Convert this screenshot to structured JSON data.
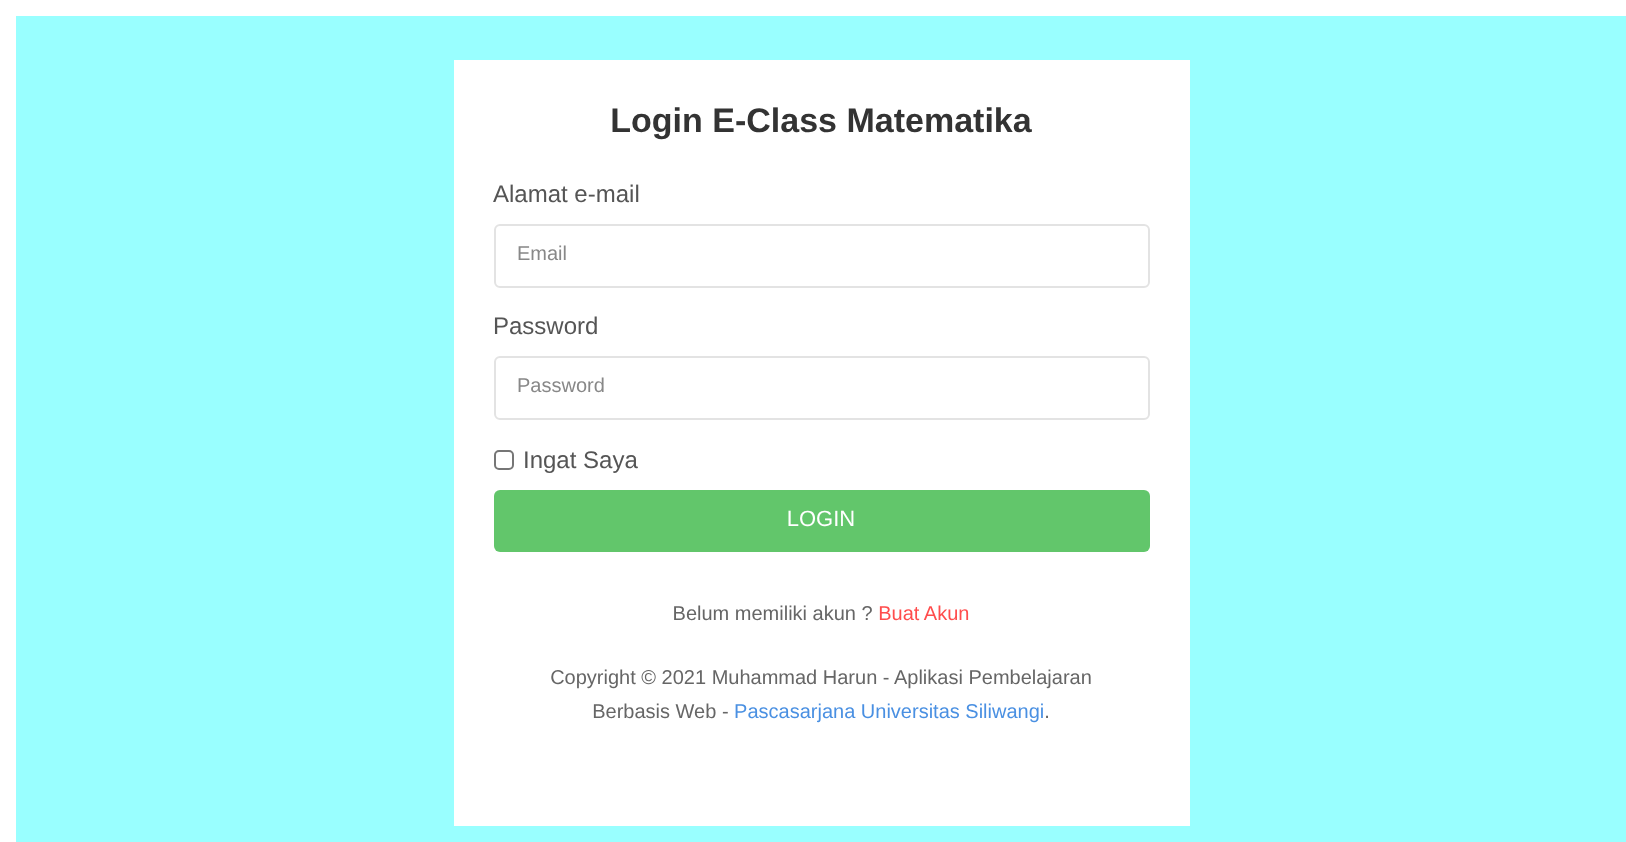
{
  "title": "Login E-Class Matematika",
  "fields": [
    {
      "label": "Alamat e-mail",
      "placeholder": "Email"
    },
    {
      "label": "Password",
      "placeholder": "Password"
    }
  ],
  "remember": {
    "label": "Ingat Saya",
    "checked": false
  },
  "login_button": "LOGIN",
  "signup": {
    "text": "Belum memiliki akun ?",
    "link": "Buat Akun"
  },
  "footer": {
    "text": "Copyright © 2021 Muhammad Harun - Aplikasi Pembelajaran Berbasis Web -",
    "link": "Pascasarjana Universitas Siliwangi",
    "suffix": "."
  }
}
